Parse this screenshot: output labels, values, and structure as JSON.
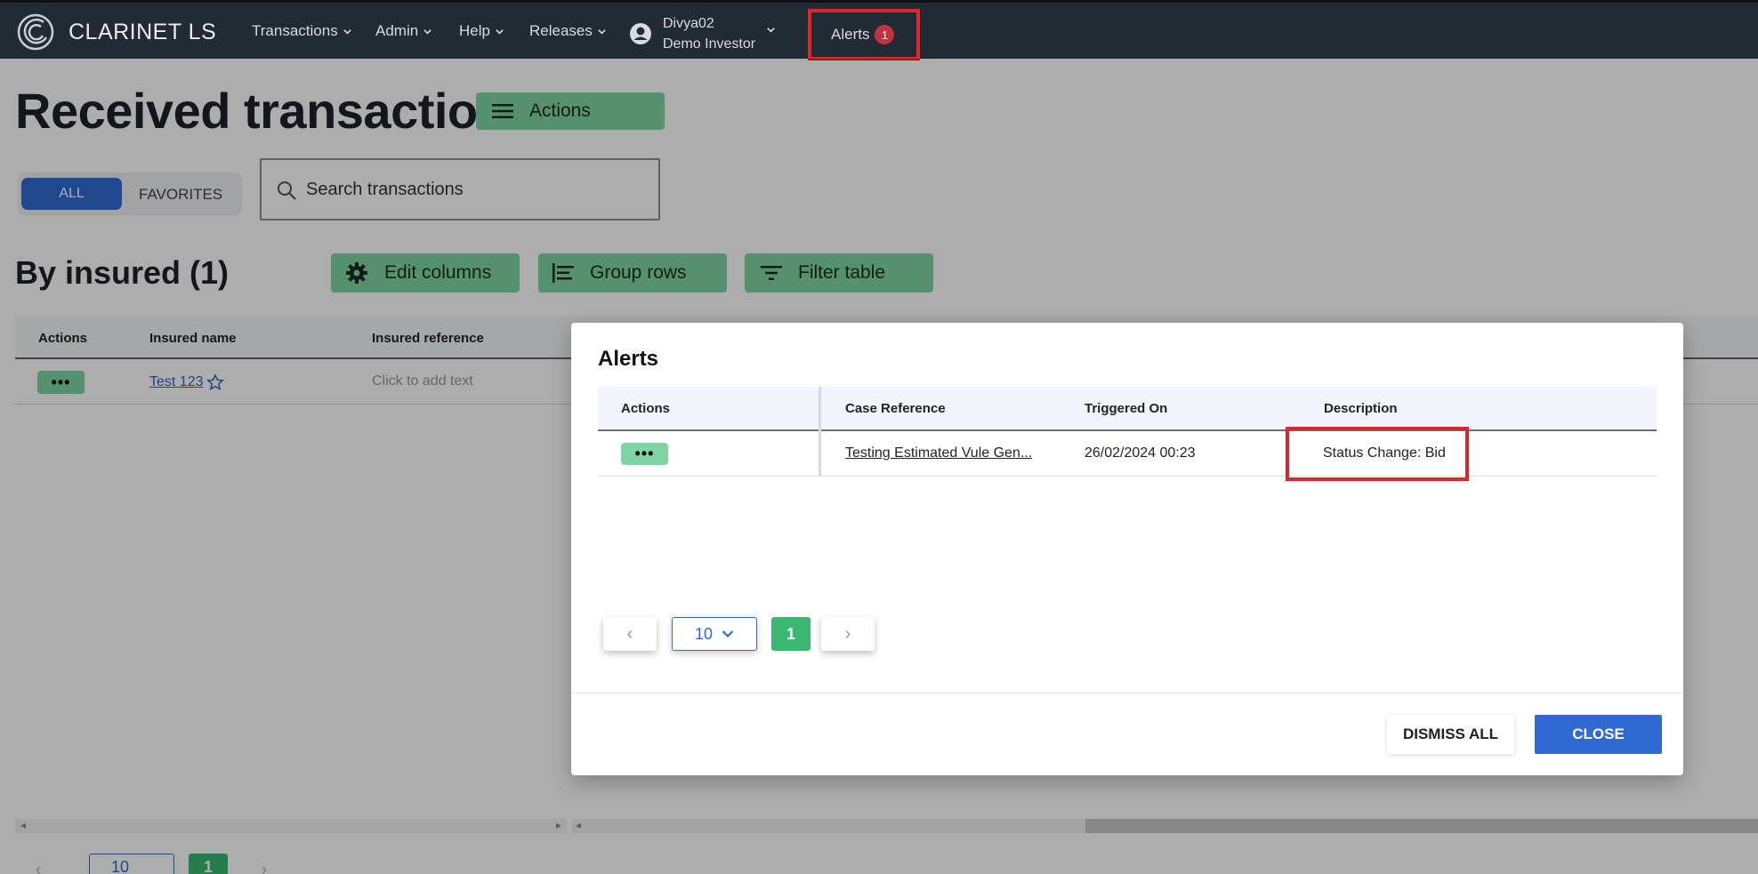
{
  "app": {
    "brand": "CLARINET LS"
  },
  "nav": {
    "items": [
      {
        "label": "Transactions"
      },
      {
        "label": "Admin"
      },
      {
        "label": "Help"
      },
      {
        "label": "Releases"
      }
    ],
    "user": {
      "name": "Divya02",
      "role": "Demo Investor"
    },
    "alerts": {
      "label": "Alerts",
      "count": "1"
    }
  },
  "page": {
    "title": "Received transactions",
    "actions_label": "Actions",
    "filter_all": "ALL",
    "filter_favorites": "FAVORITES",
    "search_placeholder": "Search transactions",
    "section_title": "By insured (1)",
    "toolbar": {
      "edit_columns": "Edit columns",
      "group_rows": "Group rows",
      "filter_table": "Filter table"
    },
    "table": {
      "columns": [
        "Actions",
        "Insured name",
        "Insured reference"
      ],
      "rows": [
        {
          "actions": "•••",
          "insured_name": "Test 123",
          "insured_reference": "Click to add text"
        }
      ]
    },
    "pager": {
      "page_size": "10",
      "current_page": "1"
    }
  },
  "modal": {
    "title": "Alerts",
    "columns": [
      "Actions",
      "Case Reference",
      "Triggered On",
      "Description"
    ],
    "rows": [
      {
        "actions": "•••",
        "case_reference": "Testing Estimated Vule Gen...",
        "triggered_on": "26/02/2024 00:23",
        "description": "Status Change: Bid"
      }
    ],
    "pager": {
      "prev": "‹",
      "page_size": "10",
      "current_page": "1",
      "next": "›"
    },
    "dismiss_all": "DISMISS ALL",
    "close": "CLOSE"
  },
  "colors": {
    "nav_bg": "#222a33",
    "accent_blue": "#2e6ad1",
    "action_green": "#7fd6a4",
    "active_page_green": "#39b970",
    "highlight_red": "#e0242c",
    "badge_red": "#c4333a"
  }
}
